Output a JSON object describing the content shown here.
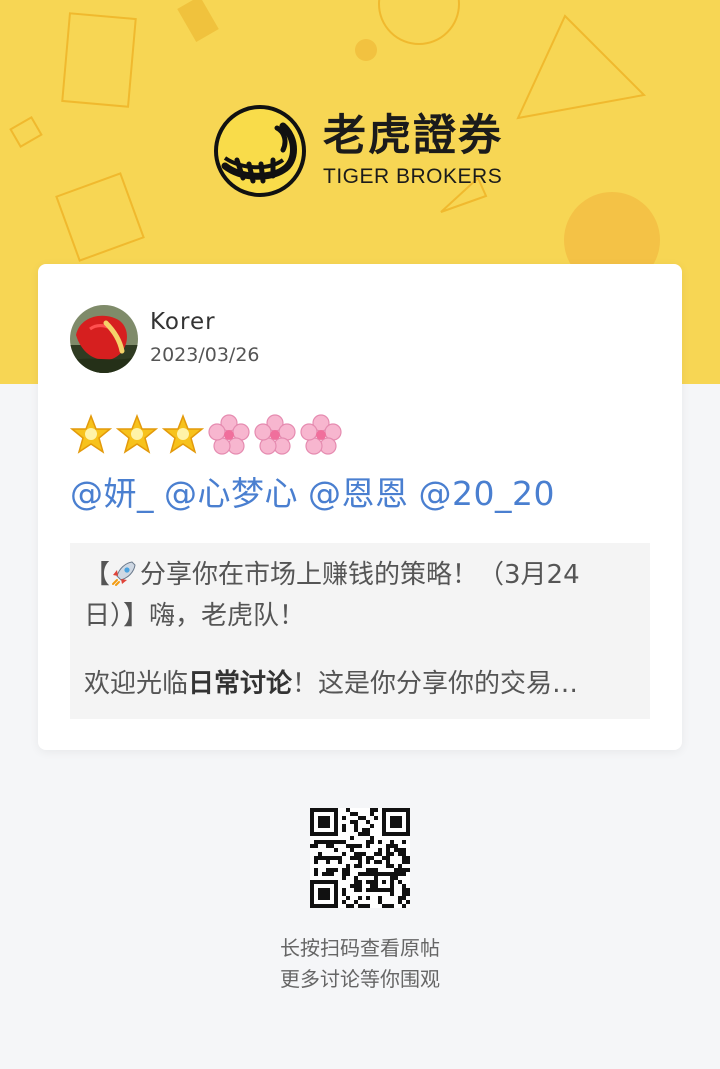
{
  "header": {
    "brand_cn": "老虎證券",
    "brand_en": "TIGER BROKERS",
    "background_color": "#f7d654",
    "logo_icon": "tiger-logo-icon"
  },
  "post": {
    "author_name": "Korer",
    "avatar_icon": "red-anthurium-flower-avatar",
    "date": "2023/03/26",
    "emoji_icons": [
      "star-icon",
      "star-icon",
      "star-icon",
      "cherry-blossom-icon",
      "cherry-blossom-icon",
      "cherry-blossom-icon"
    ],
    "mentions": [
      "@妍_",
      "@心梦心",
      "@恩恩",
      "@20_20"
    ],
    "mention_color": "#4a7fd0",
    "quote": {
      "line1_rocket_icon": "rocket-icon",
      "line1_open": "【",
      "line1_text": "分享你在市场上赚钱的策略！（3月24",
      "line2_text": "日）】嗨，老虎队！",
      "line3_prefix": "欢迎光临",
      "line3_bold": "日常讨论",
      "line3_suffix": "！这是你分享你的交易…"
    }
  },
  "footer": {
    "qr_icon": "qr-code-icon",
    "hint_line1": "长按扫码查看原帖",
    "hint_line2": "更多讨论等你围观"
  }
}
